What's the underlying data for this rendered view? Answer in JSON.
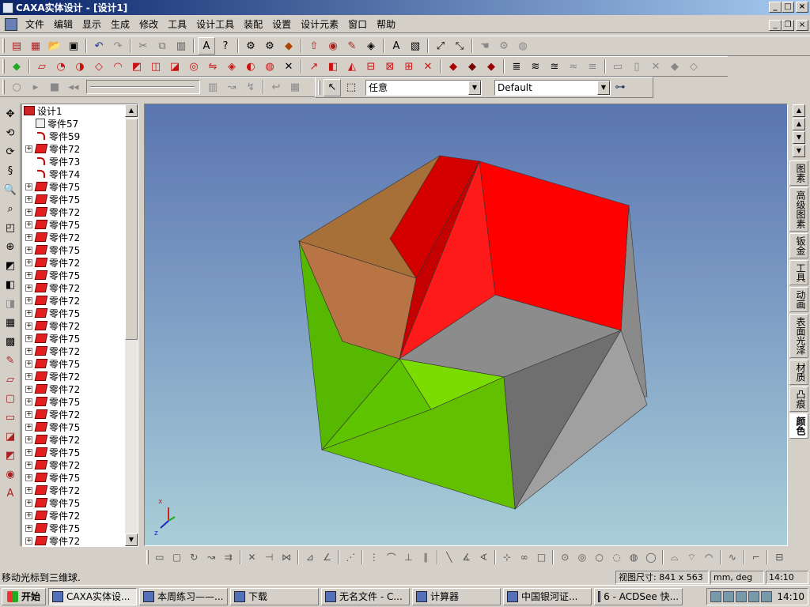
{
  "window": {
    "title": "CAXA实体设计 - [设计1]",
    "min": "_",
    "max": "□",
    "close": "×"
  },
  "menu": [
    "文件",
    "编辑",
    "显示",
    "生成",
    "修改",
    "工具",
    "设计工具",
    "装配",
    "设置",
    "设计元素",
    "窗口",
    "帮助"
  ],
  "toolbar3": {
    "filter_value": "任意",
    "style_value": "Default"
  },
  "tree": {
    "root": "设计1",
    "items": [
      {
        "label": "零件57",
        "icon": "part",
        "expand": false
      },
      {
        "label": "零件59",
        "icon": "curve",
        "expand": false
      },
      {
        "label": "零件72",
        "icon": "solid",
        "expand": true
      },
      {
        "label": "零件73",
        "icon": "curve",
        "expand": false
      },
      {
        "label": "零件74",
        "icon": "curve",
        "expand": false
      },
      {
        "label": "零件75",
        "icon": "solid",
        "expand": true
      },
      {
        "label": "零件75",
        "icon": "solid",
        "expand": true
      },
      {
        "label": "零件72",
        "icon": "solid",
        "expand": true
      },
      {
        "label": "零件75",
        "icon": "solid",
        "expand": true
      },
      {
        "label": "零件72",
        "icon": "solid",
        "expand": true
      },
      {
        "label": "零件75",
        "icon": "solid",
        "expand": true
      },
      {
        "label": "零件72",
        "icon": "solid",
        "expand": true
      },
      {
        "label": "零件75",
        "icon": "solid",
        "expand": true
      },
      {
        "label": "零件72",
        "icon": "solid",
        "expand": true
      },
      {
        "label": "零件72",
        "icon": "solid",
        "expand": true
      },
      {
        "label": "零件75",
        "icon": "solid",
        "expand": true
      },
      {
        "label": "零件72",
        "icon": "solid",
        "expand": true
      },
      {
        "label": "零件75",
        "icon": "solid",
        "expand": true
      },
      {
        "label": "零件72",
        "icon": "solid",
        "expand": true
      },
      {
        "label": "零件75",
        "icon": "solid",
        "expand": true
      },
      {
        "label": "零件72",
        "icon": "solid",
        "expand": true
      },
      {
        "label": "零件72",
        "icon": "solid",
        "expand": true
      },
      {
        "label": "零件75",
        "icon": "solid",
        "expand": true
      },
      {
        "label": "零件72",
        "icon": "solid",
        "expand": true
      },
      {
        "label": "零件75",
        "icon": "solid",
        "expand": true
      },
      {
        "label": "零件72",
        "icon": "solid",
        "expand": true
      },
      {
        "label": "零件75",
        "icon": "solid",
        "expand": true
      },
      {
        "label": "零件72",
        "icon": "solid",
        "expand": true
      },
      {
        "label": "零件75",
        "icon": "solid",
        "expand": true
      },
      {
        "label": "零件72",
        "icon": "solid",
        "expand": true
      },
      {
        "label": "零件75",
        "icon": "solid",
        "expand": true
      },
      {
        "label": "零件72",
        "icon": "solid",
        "expand": true
      },
      {
        "label": "零件75",
        "icon": "solid",
        "expand": true
      },
      {
        "label": "零件72",
        "icon": "solid",
        "expand": true
      },
      {
        "label": "零件75",
        "icon": "solid",
        "expand": true
      }
    ]
  },
  "right_tabs": [
    {
      "label": "图素",
      "active": false
    },
    {
      "label": "高级图素",
      "active": false
    },
    {
      "label": "钣金",
      "active": false
    },
    {
      "label": "工具",
      "active": false
    },
    {
      "label": "动画",
      "active": false
    },
    {
      "label": "表面光泽",
      "active": false
    },
    {
      "label": "材质",
      "active": false
    },
    {
      "label": "凸痕",
      "active": false
    },
    {
      "label": "颜色",
      "active": true
    }
  ],
  "axes": {
    "x": "x",
    "z": "z"
  },
  "status": {
    "message": "移动光标到三维球.",
    "view_size": "视图尺寸:  841 x 563",
    "units": "mm, deg",
    "time": "14:10"
  },
  "taskbar": {
    "start": "开始",
    "tasks": [
      {
        "label": "CAXA实体设...",
        "active": true
      },
      {
        "label": "本周练习——...",
        "active": false
      },
      {
        "label": "下载",
        "active": false
      },
      {
        "label": "无名文件 - C...",
        "active": false
      },
      {
        "label": "计算器",
        "active": false
      },
      {
        "label": "中国银河证...",
        "active": false
      },
      {
        "label": "6 - ACDSee 快...",
        "active": false
      }
    ],
    "clock": "14:10"
  },
  "colors": {
    "title_start": "#0a246a",
    "face_red": "#ff0000",
    "face_green": "#66cc00",
    "face_brown": "#b87040",
    "face_gray": "#7a7a7a"
  }
}
